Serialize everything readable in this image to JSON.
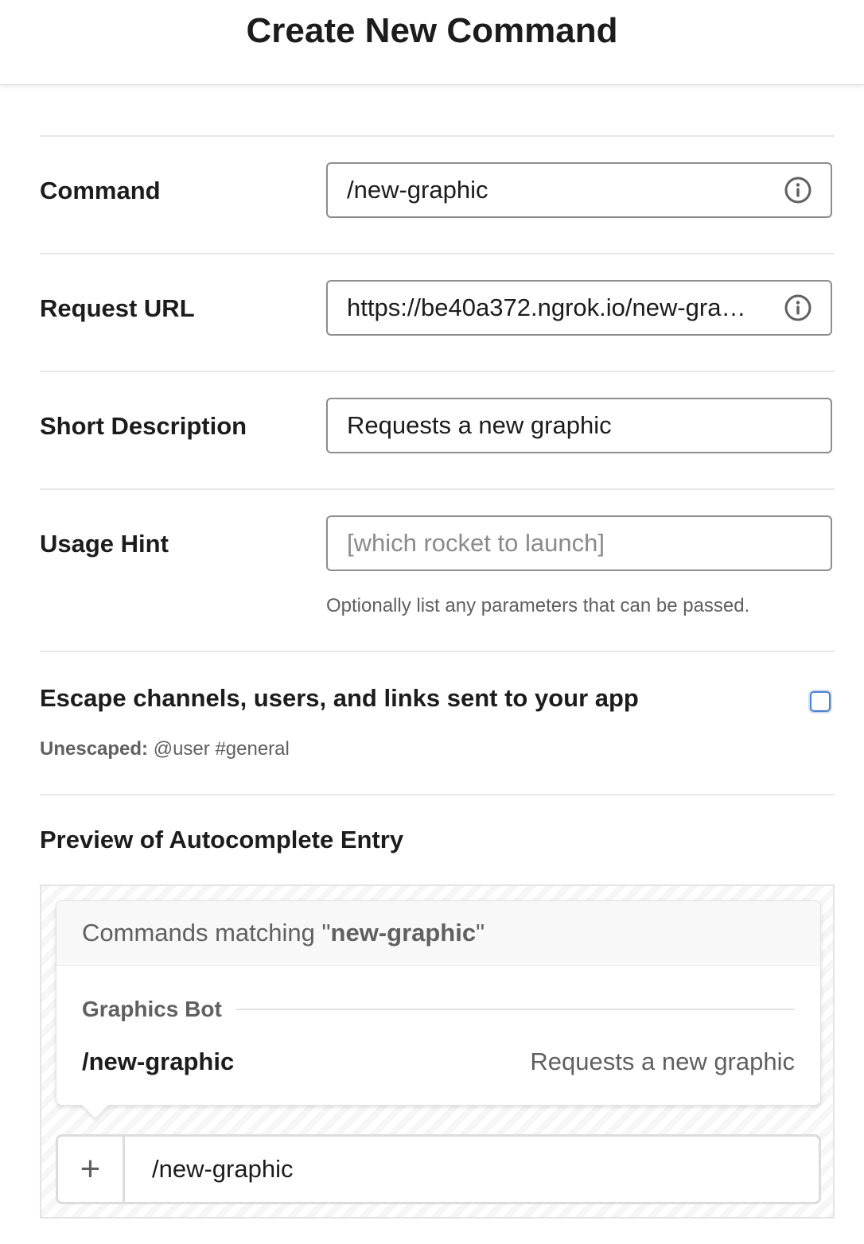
{
  "header": {
    "title": "Create New Command"
  },
  "form": {
    "command": {
      "label": "Command",
      "value": "/new-graphic"
    },
    "request_url": {
      "label": "Request URL",
      "value": "https://be40a372.ngrok.io/new-gra…"
    },
    "short_description": {
      "label": "Short Description",
      "value": "Requests a new graphic"
    },
    "usage_hint": {
      "label": "Usage Hint",
      "placeholder": "[which rocket to launch]",
      "help": "Optionally list any parameters that can be passed."
    },
    "escape": {
      "label": "Escape channels, users, and links sent to your app",
      "checked": false,
      "unescaped_label": "Unescaped:",
      "unescaped_example": "@user #general"
    }
  },
  "preview": {
    "title": "Preview of Autocomplete Entry",
    "matching_prefix": "Commands matching \"",
    "matching_term": "new-graphic",
    "matching_suffix": "\"",
    "app_name": "Graphics Bot",
    "command": "/new-graphic",
    "description": "Requests a new graphic",
    "composer_plus": "+",
    "composer_text": "/new-graphic"
  },
  "colors": {
    "checkbox_focus": "#4a7fd1",
    "text": "#1d1c1d",
    "muted": "#616061"
  },
  "icons": {
    "info": "info-icon",
    "plus": "plus-icon"
  }
}
